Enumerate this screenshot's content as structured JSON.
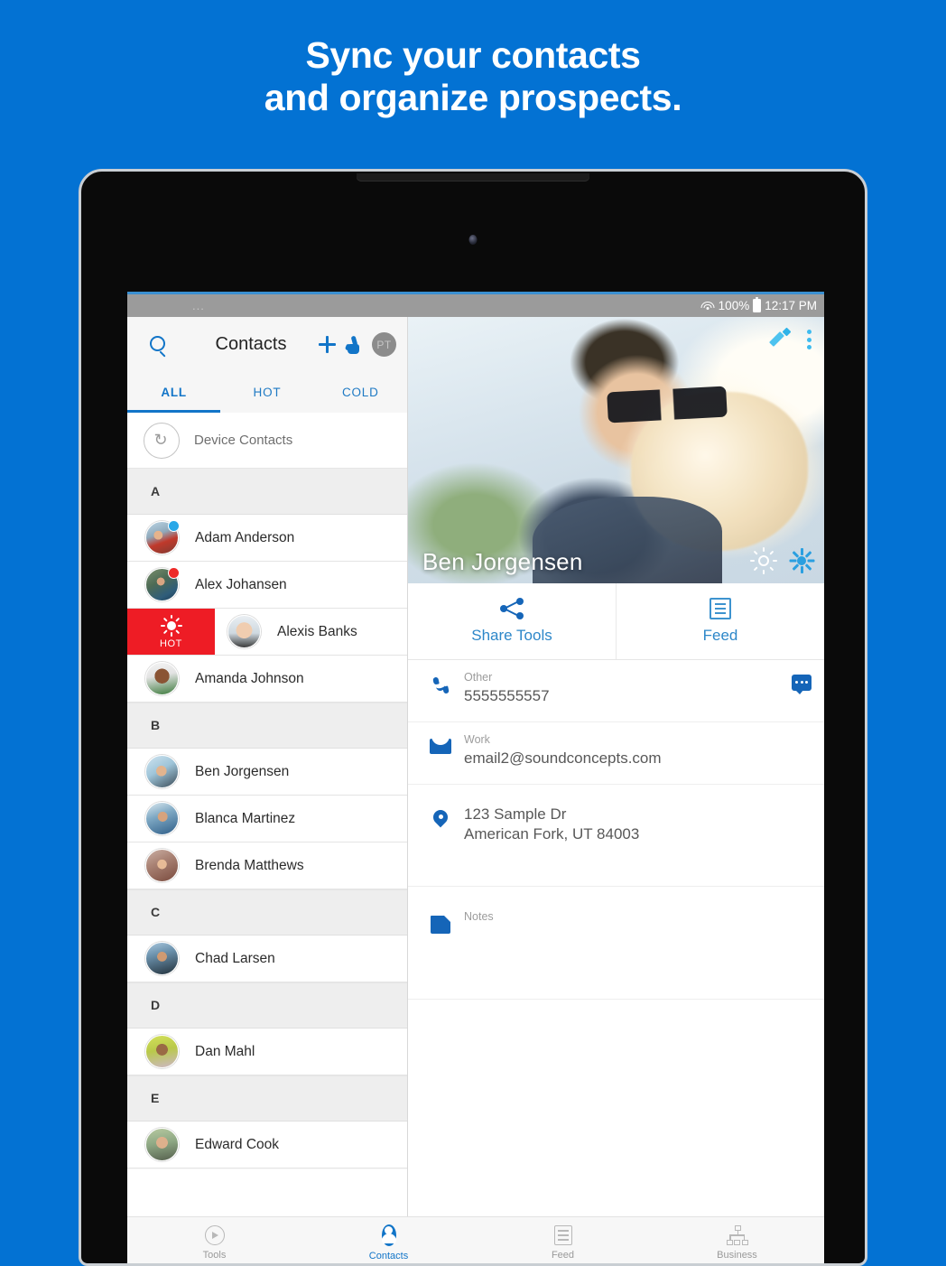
{
  "promo": {
    "line1": "Sync your contacts",
    "line2": "and organize prospects.",
    "background_color": "#0372d3"
  },
  "status_bar": {
    "dots": "...",
    "battery_percent": "100%",
    "time": "12:17 PM",
    "wifi_icon": "wifi-icon",
    "battery_icon": "battery-icon"
  },
  "app_bar": {
    "search_icon": "search-icon",
    "title": "Contacts",
    "add_icon": "plus-icon",
    "touch_icon": "hand-touch-icon",
    "avatar_initials": "PT"
  },
  "tabs": {
    "items": [
      {
        "label": "ALL",
        "active": true
      },
      {
        "label": "HOT",
        "active": false
      },
      {
        "label": "COLD",
        "active": false
      }
    ],
    "accent_color": "#1275c8"
  },
  "device_contacts": {
    "label": "Device Contacts",
    "icon": "sync-icon"
  },
  "contact_list": [
    {
      "type": "section",
      "label": "A"
    },
    {
      "type": "contact",
      "name": "Adam Anderson",
      "badge": "blue",
      "avatar": "ph1"
    },
    {
      "type": "contact",
      "name": "Alex Johansen",
      "badge": "red",
      "avatar": "ph2"
    },
    {
      "type": "contact",
      "name": "Alexis Banks",
      "badge": "none",
      "avatar": "ph3",
      "swipe_action": "HOT",
      "swipe_color": "#ee1c25"
    },
    {
      "type": "contact",
      "name": "Amanda Johnson",
      "badge": "none",
      "avatar": "ph4"
    },
    {
      "type": "section",
      "label": "B"
    },
    {
      "type": "contact",
      "name": "Ben Jorgensen",
      "badge": "none",
      "avatar": "ph5"
    },
    {
      "type": "contact",
      "name": "Blanca Martinez",
      "badge": "none",
      "avatar": "ph6"
    },
    {
      "type": "contact",
      "name": "Brenda Matthews",
      "badge": "none",
      "avatar": "ph7"
    },
    {
      "type": "section",
      "label": "C"
    },
    {
      "type": "contact",
      "name": "Chad Larsen",
      "badge": "none",
      "avatar": "ph8"
    },
    {
      "type": "section",
      "label": "D"
    },
    {
      "type": "contact",
      "name": "Dan Mahl",
      "badge": "none",
      "avatar": "ph9"
    },
    {
      "type": "section",
      "label": "E"
    },
    {
      "type": "contact",
      "name": "Edward Cook",
      "badge": "none",
      "avatar": "ph10"
    }
  ],
  "detail": {
    "hero": {
      "name": "Ben Jorgensen",
      "edit_icon": "pencil-icon",
      "overflow_icon": "kebab-menu-icon",
      "hot_icon": "sun-hot-icon",
      "cold_icon": "snowflake-cold-icon"
    },
    "actions": [
      {
        "label": "Share Tools",
        "icon": "share-icon"
      },
      {
        "label": "Feed",
        "icon": "feed-icon"
      }
    ],
    "fields": [
      {
        "icon": "phone-icon",
        "label": "Other",
        "value": "5555555557",
        "trailing_icon": "message-icon"
      },
      {
        "icon": "mail-icon",
        "label": "Work",
        "value": "email2@soundconcepts.com"
      },
      {
        "icon": "location-pin-icon",
        "label": "",
        "value": "123 Sample Dr",
        "value2": "American Fork, UT 84003"
      },
      {
        "icon": "note-icon",
        "label": "Notes",
        "value": ""
      }
    ]
  },
  "bottom_nav": [
    {
      "label": "Tools",
      "icon": "tools-play-icon",
      "active": false
    },
    {
      "label": "Contacts",
      "icon": "contacts-person-icon",
      "active": true
    },
    {
      "label": "Feed",
      "icon": "feed-list-icon",
      "active": false
    },
    {
      "label": "Business",
      "icon": "business-org-icon",
      "active": false
    }
  ]
}
